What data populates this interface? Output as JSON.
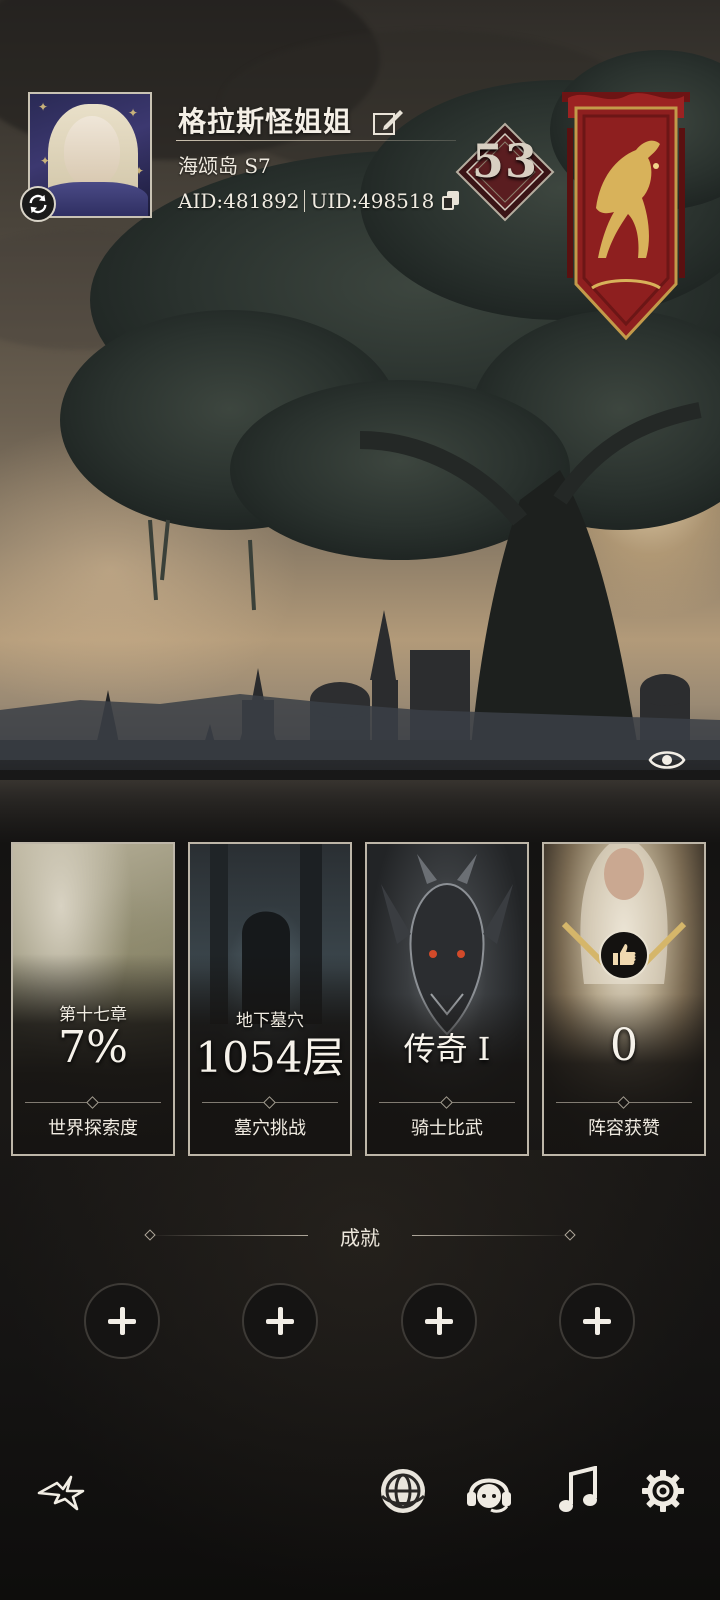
{
  "profile": {
    "nickname": "格拉斯怪姐姐",
    "server": "海颂岛 S7",
    "aid": "AID:481892",
    "uid": "UID:498518",
    "level": "53"
  },
  "cards": [
    {
      "subtitle": "第十七章",
      "value": "7%",
      "label": "世界探索度"
    },
    {
      "subtitle": "地下墓穴",
      "value": "1054层",
      "label": "墓穴挑战"
    },
    {
      "subtitle": "",
      "value": "传奇 I",
      "label": "骑士比武"
    },
    {
      "subtitle": "",
      "value": "0",
      "label": "阵容获赞"
    }
  ],
  "achievements": {
    "title": "成就",
    "slot_count": 4
  },
  "icons": {
    "avatar_swap": "refresh-icon",
    "edit_name": "edit-icon",
    "copy_id": "copy-icon",
    "visibility": "eye-icon",
    "toolbar": [
      "logo-icon",
      "globe-icon",
      "support-icon",
      "music-icon",
      "gear-icon"
    ]
  },
  "colors": {
    "banner_red": "#8e1f1f",
    "banner_gold": "#d8b25a",
    "card_border": "#bdb6a8",
    "text": "#f1ece2"
  }
}
